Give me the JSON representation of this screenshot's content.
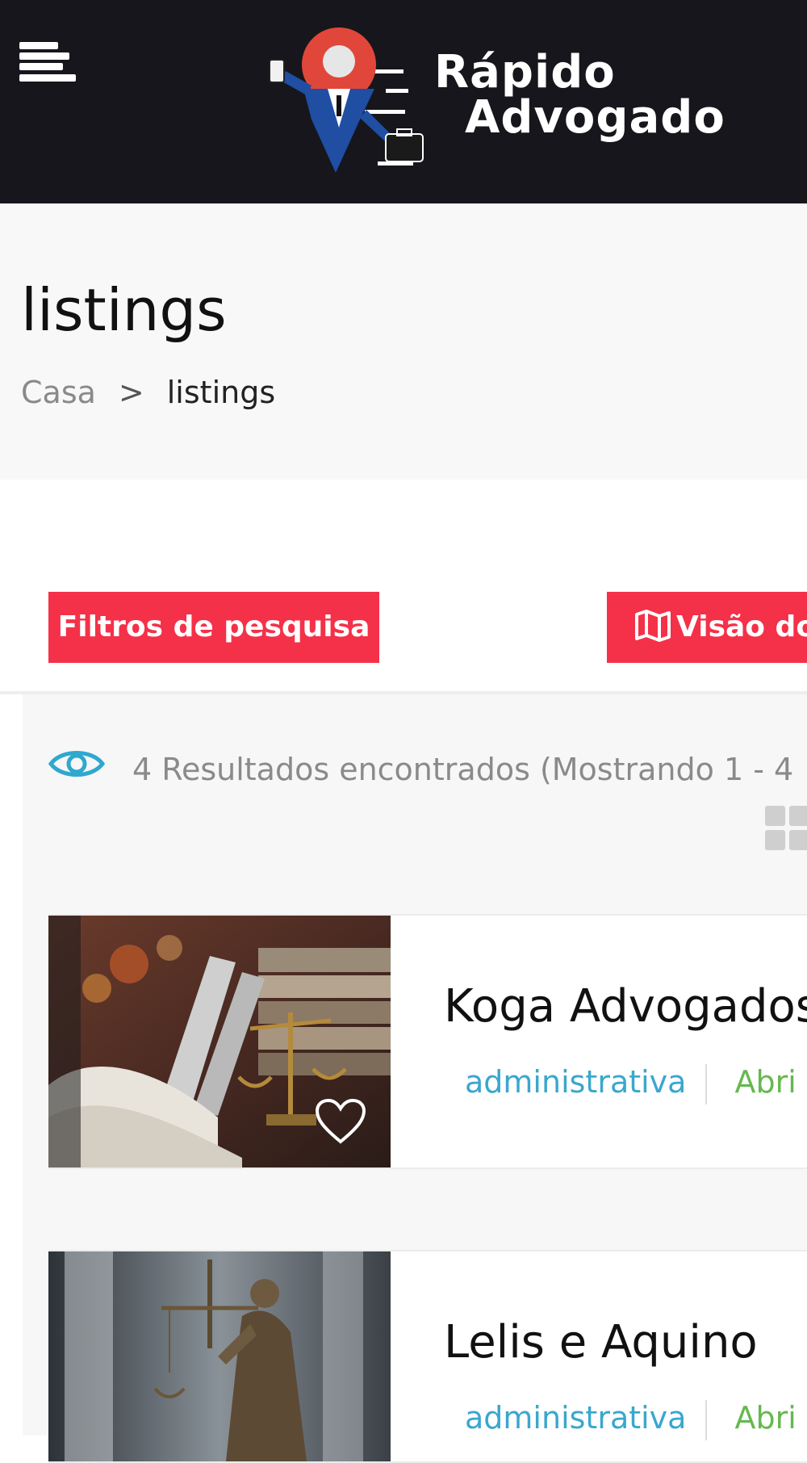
{
  "header": {
    "brand_line1": "Rápido",
    "brand_line2": "Advogado",
    "menu_icon": "hamburger-menu-icon"
  },
  "page": {
    "title": "listings",
    "breadcrumb": {
      "home": "Casa",
      "separator": ">",
      "current": "listings"
    }
  },
  "toolbar": {
    "filters_label": "Filtros de pesquisa",
    "map_label": "Visão do",
    "map_icon": "map-icon"
  },
  "results": {
    "summary": "4 Resultados encontrados (Mostrando 1 - 4",
    "eye_icon": "eye-icon",
    "view_toggle_icon": "grid-view-icon"
  },
  "listings": [
    {
      "name": "Koga Advogados",
      "category": "administrativa",
      "status": "Abri",
      "image": "books-and-scales-photo"
    },
    {
      "name": "Lelis e Aquino",
      "category": "administrativa",
      "status": "Abri",
      "image": "lady-justice-statue-photo"
    }
  ],
  "colors": {
    "header_bg": "#16161c",
    "accent_red": "#f43148",
    "link_blue": "#3aa7cd",
    "status_green": "#66b84f",
    "muted_text": "#8a8a8a"
  }
}
